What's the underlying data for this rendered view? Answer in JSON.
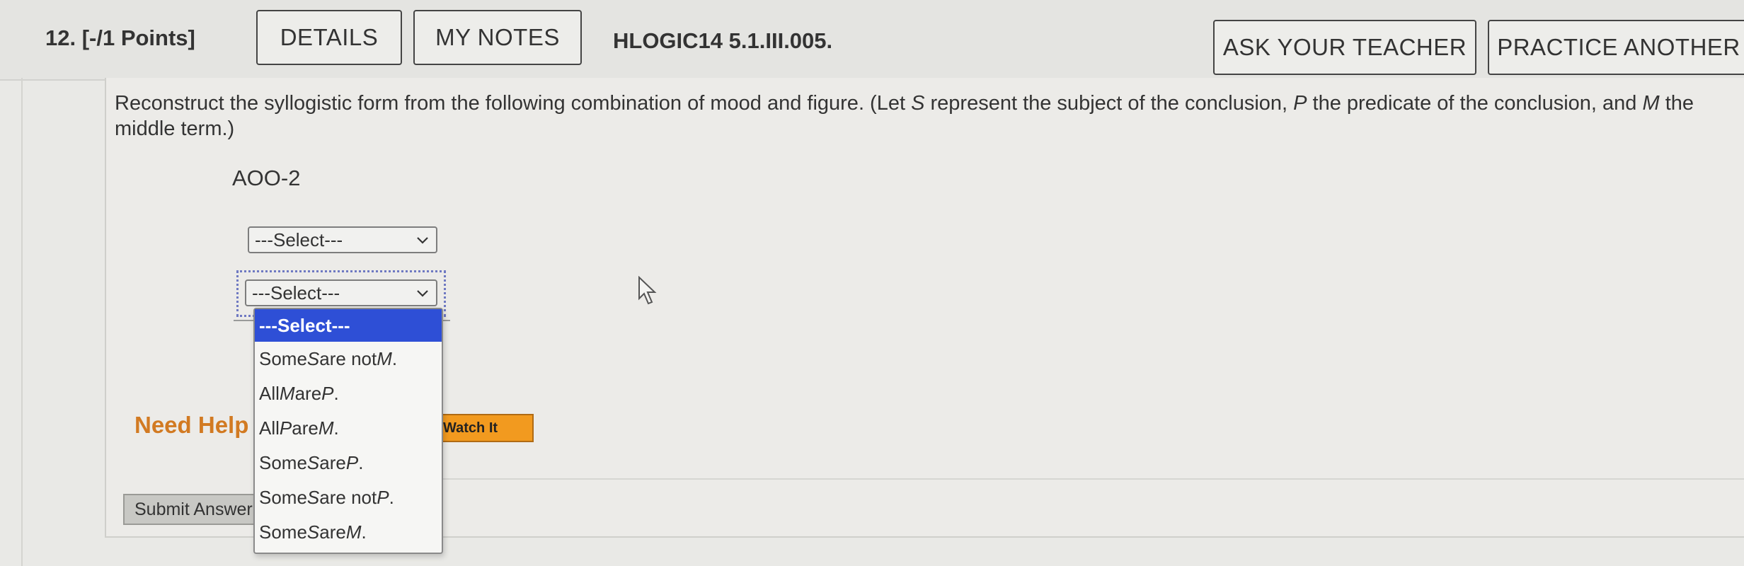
{
  "question": {
    "number_points": "12.  [-/1 Points]",
    "id": "HLOGIC14 5.1.III.005."
  },
  "header": {
    "details_label": "DETAILS",
    "my_notes_label": "MY NOTES",
    "ask_teacher_label": "ASK YOUR TEACHER",
    "practice_another_label": "PRACTICE ANOTHER"
  },
  "prompt": {
    "part1": "Reconstruct the syllogistic form from the following combination of mood and figure. (Let ",
    "var_s": "S",
    "part2": " represent the subject of the conclusion, ",
    "var_p": "P",
    "part3": " the predicate of the conclusion, and ",
    "var_m": "M",
    "part4": " the middle term.)"
  },
  "form_code": "AOO-2",
  "select1": {
    "value": "---Select---"
  },
  "select2": {
    "value": "---Select---"
  },
  "dropdown": {
    "selected": "---Select---",
    "options": [
      {
        "pre": "Some ",
        "a": "S",
        "mid": " are not ",
        "b": "M",
        "post": "."
      },
      {
        "pre": "All ",
        "a": "M",
        "mid": " are ",
        "b": "P",
        "post": "."
      },
      {
        "pre": "All ",
        "a": "P",
        "mid": " are ",
        "b": "M",
        "post": "."
      },
      {
        "pre": "Some ",
        "a": "S",
        "mid": " are ",
        "b": "P",
        "post": "."
      },
      {
        "pre": "Some ",
        "a": "S",
        "mid": " are not ",
        "b": "P",
        "post": "."
      },
      {
        "pre": "Some ",
        "a": "S",
        "mid": " are ",
        "b": "M",
        "post": "."
      }
    ]
  },
  "help": {
    "need_help_label": "Need Help",
    "watch_it_label": "Watch It"
  },
  "submit_label": "Submit Answer",
  "icons": {
    "cursor": "mouse-pointer-icon",
    "chevron": "chevron-down-icon"
  }
}
